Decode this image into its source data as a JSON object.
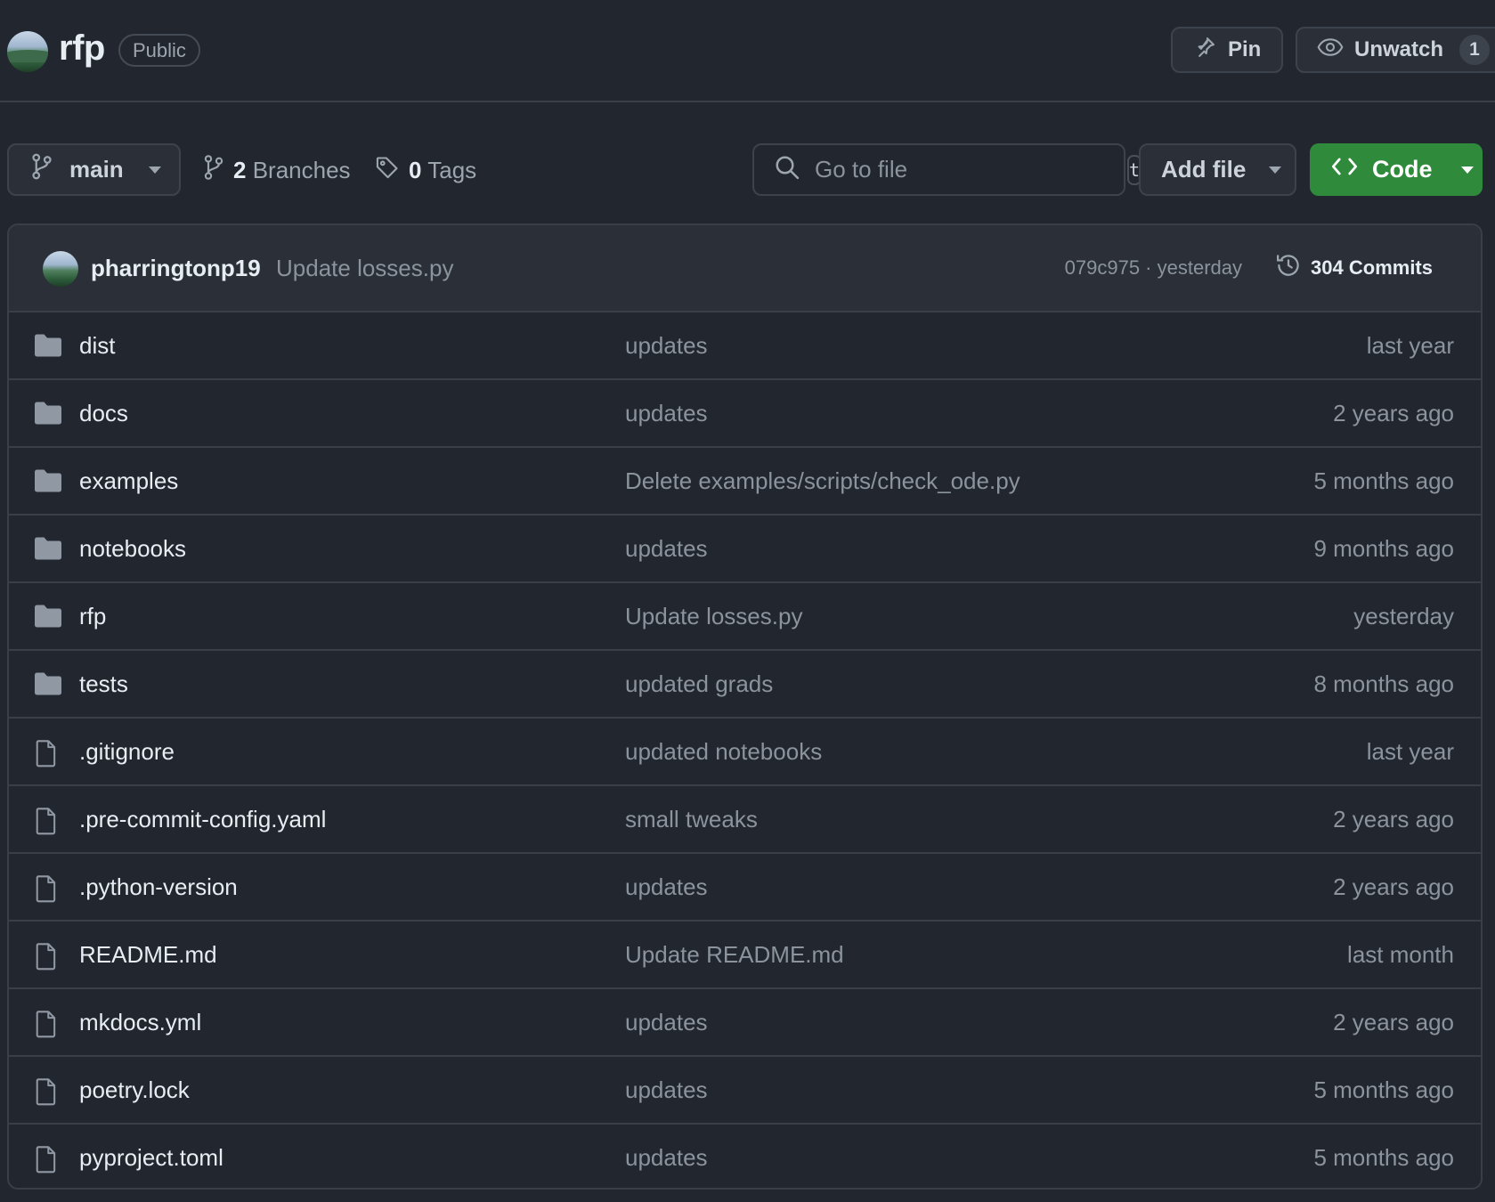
{
  "repo": {
    "name": "rfp",
    "visibility": "Public"
  },
  "header_actions": {
    "pin_label": "Pin",
    "unwatch_label": "Unwatch",
    "watch_count": "1"
  },
  "toolbar": {
    "branch": "main",
    "branches_count": "2",
    "branches_label": "Branches",
    "tags_count": "0",
    "tags_label": "Tags",
    "goto_file_placeholder": "Go to file",
    "goto_file_shortcut": "t",
    "add_file_label": "Add file",
    "code_label": "Code"
  },
  "latest_commit": {
    "author": "pharringtonp19",
    "message": "Update losses.py",
    "meta": "079c975 · yesterday",
    "commits_label": "304 Commits"
  },
  "files": [
    {
      "name": "dist",
      "type": "folder",
      "message": "updates",
      "date": "last year"
    },
    {
      "name": "docs",
      "type": "folder",
      "message": "updates",
      "date": "2 years ago"
    },
    {
      "name": "examples",
      "type": "folder",
      "message": "Delete examples/scripts/check_ode.py",
      "date": "5 months ago"
    },
    {
      "name": "notebooks",
      "type": "folder",
      "message": "updates",
      "date": "9 months ago"
    },
    {
      "name": "rfp",
      "type": "folder",
      "message": "Update losses.py",
      "date": "yesterday"
    },
    {
      "name": "tests",
      "type": "folder",
      "message": "updated grads",
      "date": "8 months ago"
    },
    {
      "name": ".gitignore",
      "type": "file",
      "message": "updated notebooks",
      "date": "last year"
    },
    {
      "name": ".pre-commit-config.yaml",
      "type": "file",
      "message": "small tweaks",
      "date": "2 years ago"
    },
    {
      "name": ".python-version",
      "type": "file",
      "message": "updates",
      "date": "2 years ago"
    },
    {
      "name": "README.md",
      "type": "file",
      "message": "Update README.md",
      "date": "last month"
    },
    {
      "name": "mkdocs.yml",
      "type": "file",
      "message": "updates",
      "date": "2 years ago"
    },
    {
      "name": "poetry.lock",
      "type": "file",
      "message": "updates",
      "date": "5 months ago"
    },
    {
      "name": "pyproject.toml",
      "type": "file",
      "message": "updates",
      "date": "5 months ago"
    }
  ],
  "colors": {
    "background": "#22262e",
    "code_button": "#2f8a3c",
    "border": "#3a3f47"
  }
}
